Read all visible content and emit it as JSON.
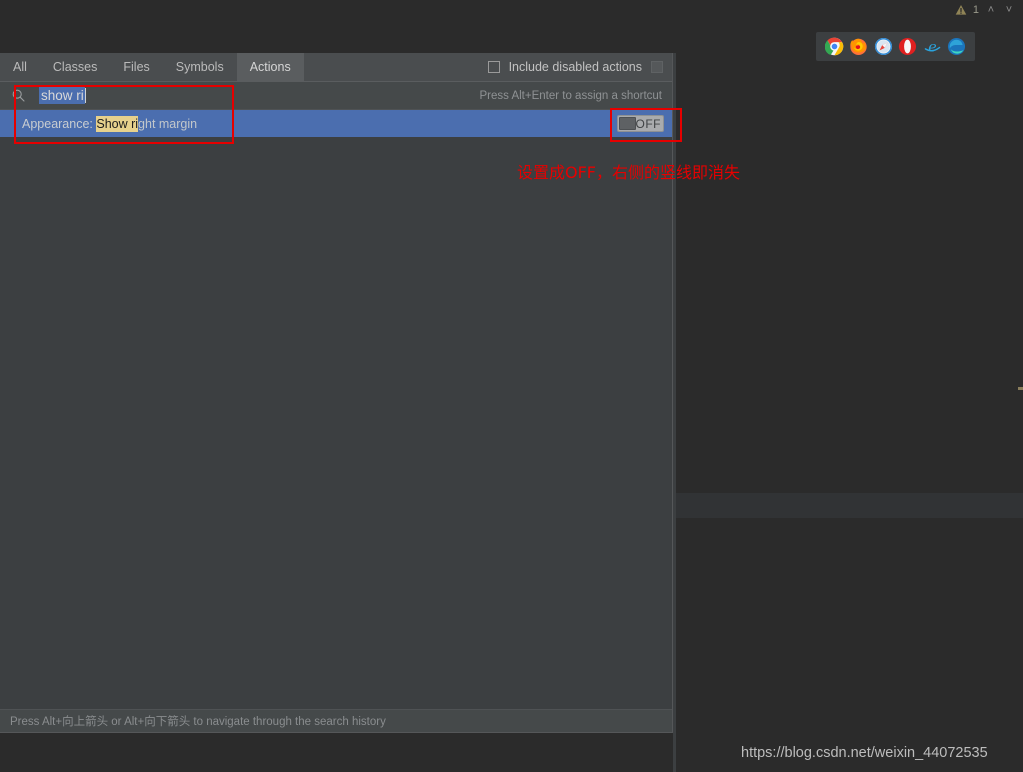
{
  "status_bar": {
    "warning_icon": "warning-triangle-icon",
    "warning_count": "1",
    "chevron_up": "˄",
    "chevron_down": "˅"
  },
  "browser_bar": {
    "browsers": [
      {
        "name": "chrome-icon",
        "title": "Chrome"
      },
      {
        "name": "firefox-icon",
        "title": "Firefox"
      },
      {
        "name": "safari-icon",
        "title": "Safari"
      },
      {
        "name": "opera-icon",
        "title": "Opera"
      },
      {
        "name": "internet-explorer-icon",
        "title": "Internet Explorer"
      },
      {
        "name": "edge-icon",
        "title": "Edge"
      }
    ]
  },
  "search_everywhere": {
    "tabs": [
      {
        "label": "All",
        "selected": false
      },
      {
        "label": "Classes",
        "selected": false
      },
      {
        "label": "Files",
        "selected": false
      },
      {
        "label": "Symbols",
        "selected": false
      },
      {
        "label": "Actions",
        "selected": true
      }
    ],
    "include_disabled_label": "Include disabled actions",
    "include_disabled_checked": false,
    "filter_icon": "filter-icon",
    "search_icon": "search-icon",
    "query": "show ri",
    "query_selected": true,
    "shortcut_hint": "Press Alt+Enter to assign a shortcut",
    "results": [
      {
        "prefix": "Appearance: ",
        "match": "Show ri",
        "suffix": "ght margin",
        "selected": true,
        "toggle_label": "OFF",
        "toggle_state": "off"
      }
    ],
    "footer_hint": "Press Alt+向上箭头 or Alt+向下箭头 to navigate through the search history"
  },
  "annotations": {
    "note_text": "设置成OFF，右侧的竖线即消失",
    "color": "#e60000",
    "boxes": [
      {
        "name": "search-input-highlight"
      },
      {
        "name": "toggle-highlight"
      }
    ]
  },
  "watermark": {
    "text": "https://blog.csdn.net/weixin_44072535"
  },
  "colors": {
    "ide_background": "#2b2b2b",
    "popup_background": "#3c3f41",
    "tab_bar": "#4a4d4f",
    "tab_selected": "#5a5d5f",
    "search_row": "#45494a",
    "selection_blue": "#4b6eaf",
    "match_highlight": "#e7d18c",
    "annotation_red": "#e60000"
  }
}
